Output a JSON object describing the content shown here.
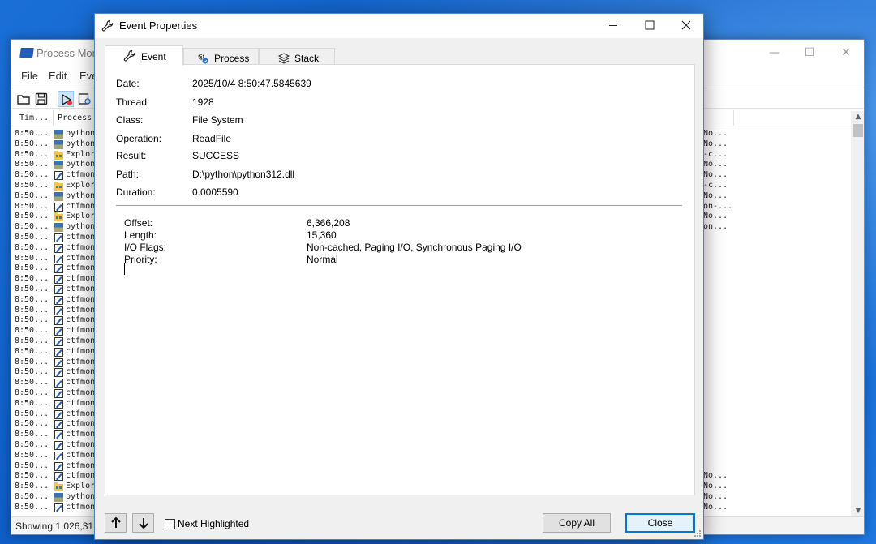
{
  "process_monitor": {
    "title": "Process Mon",
    "menu": [
      "File",
      "Edit",
      "Eve"
    ],
    "columns": [
      "Tim...",
      "Process"
    ],
    "rows": [
      {
        "time": "8:50...",
        "process": "python",
        "icon": "python-icon",
        "right": "No..."
      },
      {
        "time": "8:50...",
        "process": "python",
        "icon": "python-icon",
        "right": "No..."
      },
      {
        "time": "8:50...",
        "process": "Explor",
        "icon": "explorer-icon",
        "right": "-c..."
      },
      {
        "time": "8:50...",
        "process": "python",
        "icon": "python-icon",
        "right": "No..."
      },
      {
        "time": "8:50...",
        "process": "ctfmon",
        "icon": "ctfmon-icon",
        "right": "No..."
      },
      {
        "time": "8:50...",
        "process": "Explor",
        "icon": "explorer-icon",
        "right": "-c..."
      },
      {
        "time": "8:50...",
        "process": "python",
        "icon": "python-icon",
        "right": "No..."
      },
      {
        "time": "8:50...",
        "process": "ctfmon",
        "icon": "ctfmon-icon",
        "right": "on-..."
      },
      {
        "time": "8:50...",
        "process": "Explor",
        "icon": "explorer-icon",
        "right": "No..."
      },
      {
        "time": "8:50...",
        "process": "python",
        "icon": "python-icon",
        "right": "on..."
      },
      {
        "time": "8:50...",
        "process": "ctfmon",
        "icon": "ctfmon-icon",
        "right": ""
      },
      {
        "time": "8:50...",
        "process": "ctfmon",
        "icon": "ctfmon-icon",
        "right": ""
      },
      {
        "time": "8:50...",
        "process": "ctfmon",
        "icon": "ctfmon-icon",
        "right": ""
      },
      {
        "time": "8:50...",
        "process": "ctfmon",
        "icon": "ctfmon-icon",
        "right": ""
      },
      {
        "time": "8:50...",
        "process": "ctfmon",
        "icon": "ctfmon-icon",
        "right": ""
      },
      {
        "time": "8:50...",
        "process": "ctfmon",
        "icon": "ctfmon-icon",
        "right": ""
      },
      {
        "time": "8:50...",
        "process": "ctfmon",
        "icon": "ctfmon-icon",
        "right": ""
      },
      {
        "time": "8:50...",
        "process": "ctfmon",
        "icon": "ctfmon-icon",
        "right": ""
      },
      {
        "time": "8:50...",
        "process": "ctfmon",
        "icon": "ctfmon-icon",
        "right": ""
      },
      {
        "time": "8:50...",
        "process": "ctfmon",
        "icon": "ctfmon-icon",
        "right": ""
      },
      {
        "time": "8:50...",
        "process": "ctfmon",
        "icon": "ctfmon-icon",
        "right": ""
      },
      {
        "time": "8:50...",
        "process": "ctfmon",
        "icon": "ctfmon-icon",
        "right": ""
      },
      {
        "time": "8:50...",
        "process": "ctfmon",
        "icon": "ctfmon-icon",
        "right": ""
      },
      {
        "time": "8:50...",
        "process": "ctfmon",
        "icon": "ctfmon-icon",
        "right": ""
      },
      {
        "time": "8:50...",
        "process": "ctfmon",
        "icon": "ctfmon-icon",
        "right": ""
      },
      {
        "time": "8:50...",
        "process": "ctfmon",
        "icon": "ctfmon-icon",
        "right": ""
      },
      {
        "time": "8:50...",
        "process": "ctfmon",
        "icon": "ctfmon-icon",
        "right": ""
      },
      {
        "time": "8:50...",
        "process": "ctfmon",
        "icon": "ctfmon-icon",
        "right": ""
      },
      {
        "time": "8:50...",
        "process": "ctfmon",
        "icon": "ctfmon-icon",
        "right": ""
      },
      {
        "time": "8:50...",
        "process": "ctfmon",
        "icon": "ctfmon-icon",
        "right": ""
      },
      {
        "time": "8:50...",
        "process": "ctfmon",
        "icon": "ctfmon-icon",
        "right": ""
      },
      {
        "time": "8:50...",
        "process": "ctfmon",
        "icon": "ctfmon-icon",
        "right": ""
      },
      {
        "time": "8:50...",
        "process": "ctfmon",
        "icon": "ctfmon-icon",
        "right": ""
      },
      {
        "time": "8:50...",
        "process": "ctfmon",
        "icon": "ctfmon-icon",
        "right": "No..."
      },
      {
        "time": "8:50...",
        "process": "Explor",
        "icon": "explorer-icon",
        "right": "No..."
      },
      {
        "time": "8:50...",
        "process": "python",
        "icon": "python-icon",
        "right": "No..."
      },
      {
        "time": "8:50...",
        "process": "ctfmon",
        "icon": "ctfmon-icon",
        "right": "No..."
      }
    ],
    "status": "Showing 1,026,31"
  },
  "dialog": {
    "title": "Event Properties",
    "tabs": [
      {
        "label": "Event",
        "icon": "wrench-icon",
        "selected": true
      },
      {
        "label": "Process",
        "icon": "gears-icon",
        "selected": false
      },
      {
        "label": "Stack",
        "icon": "layers-icon",
        "selected": false
      }
    ],
    "properties": [
      {
        "label": "Date:",
        "value": "2025/10/4 8:50:47.5845639"
      },
      {
        "label": "Thread:",
        "value": "1928"
      },
      {
        "label": "Class:",
        "value": "File System"
      },
      {
        "label": "Operation:",
        "value": "ReadFile"
      },
      {
        "label": "Result:",
        "value": "SUCCESS"
      },
      {
        "label": "Path:",
        "value": "D:\\python\\python312.dll"
      },
      {
        "label": "Duration:",
        "value": "0.0005590"
      }
    ],
    "details": [
      {
        "label": "Offset:",
        "value": "6,366,208"
      },
      {
        "label": "Length:",
        "value": "15,360"
      },
      {
        "label": "I/O Flags:",
        "value": "Non-cached, Paging I/O, Synchronous Paging I/O"
      },
      {
        "label": "Priority:",
        "value": "Normal"
      }
    ],
    "next_highlighted_label": "Next Highlighted",
    "next_highlighted_checked": false,
    "copy_all_label": "Copy All",
    "close_label": "Close"
  },
  "colors": {
    "desktop": "#1565d0",
    "accent": "#0078d7",
    "dialog_border": "#4d83c8"
  }
}
